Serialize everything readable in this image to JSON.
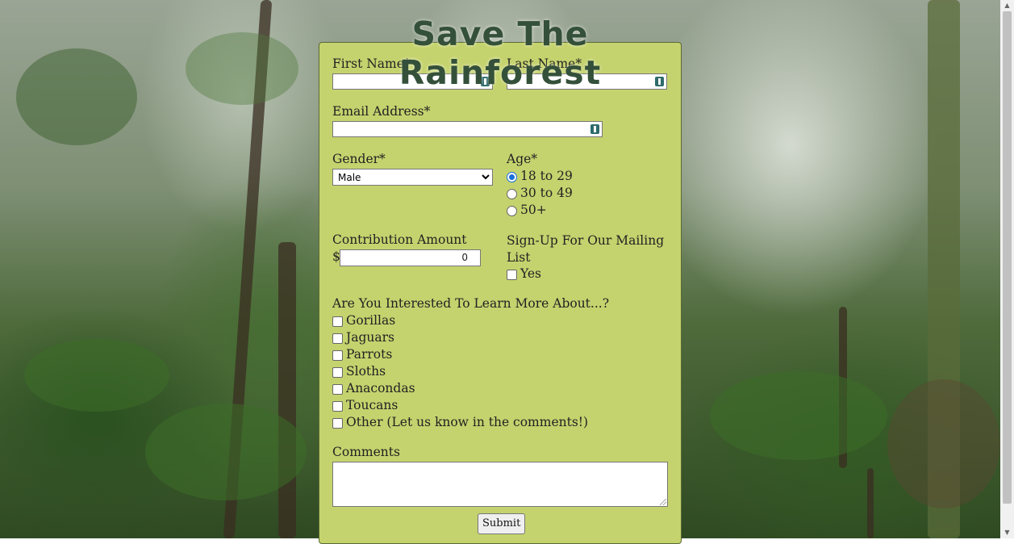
{
  "page_title": "Save The Rainforest",
  "fields": {
    "first_name_label": "First Name*",
    "last_name_label": "Last Name*",
    "email_label": "Email Address*",
    "gender_label": "Gender*",
    "gender_selected": "Male",
    "age_label": "Age*",
    "age_options": [
      "18 to 29",
      "30 to 49",
      "50+"
    ],
    "age_selected": "18 to 29",
    "contribution_label": "Contribution Amount",
    "currency_symbol": "$",
    "contribution_value": "0",
    "mailing_label": "Sign-Up For Our Mailing List",
    "mailing_option": "Yes",
    "interests_label": "Are You Interested To Learn More About...?",
    "interests": [
      "Gorillas",
      "Jaguars",
      "Parrots",
      "Sloths",
      "Anacondas",
      "Toucans",
      "Other (Let us know in the comments!)"
    ],
    "comments_label": "Comments",
    "submit_label": "Submit"
  },
  "icons": {
    "field_icon": "password-manager-icon"
  },
  "colors": {
    "form_background": "#c5d36e",
    "title_color": "#34503a",
    "radio_selected": "#1a6fd6"
  }
}
